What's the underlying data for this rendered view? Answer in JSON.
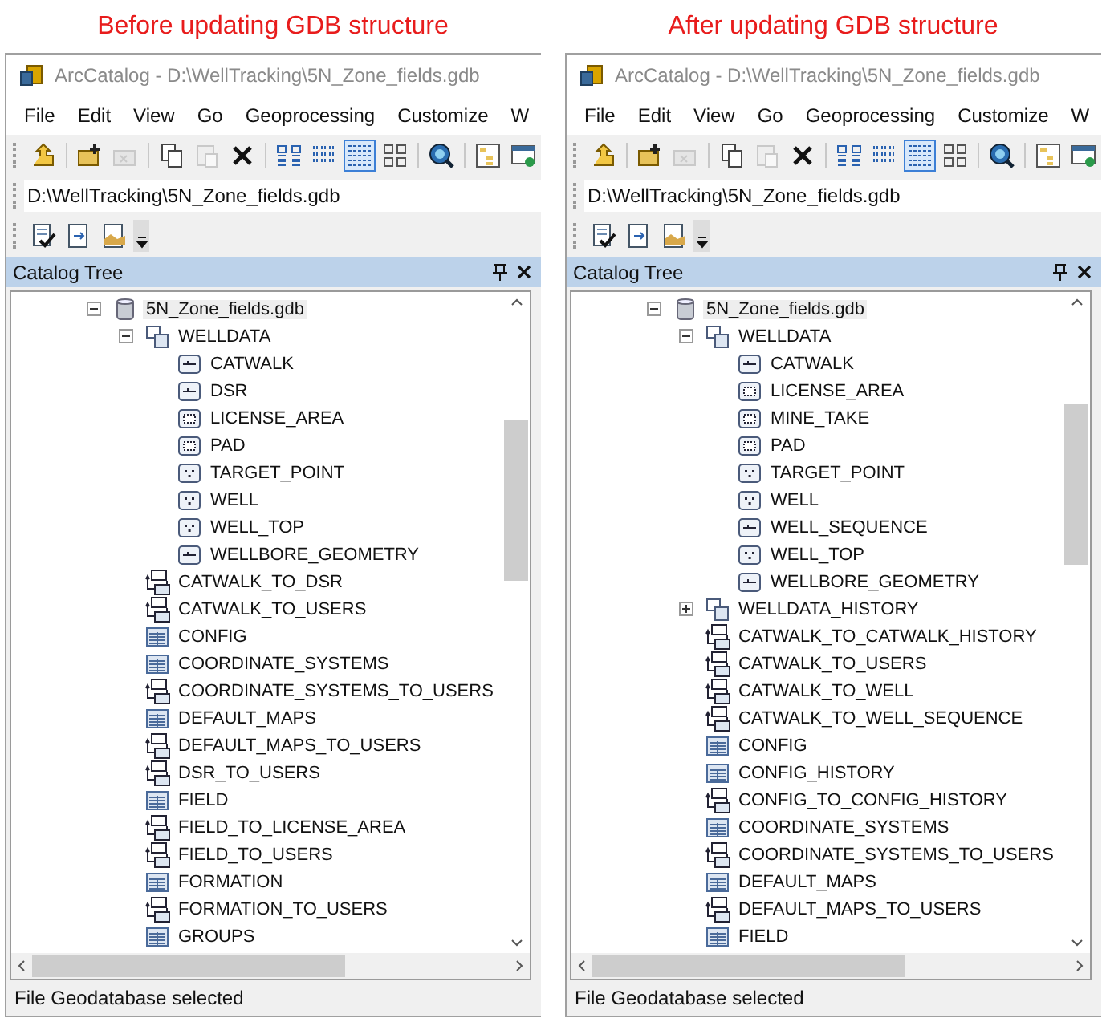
{
  "panels": [
    {
      "caption": "Before updating GDB structure",
      "window": {
        "title": "ArcCatalog - D:\\WellTracking\\5N_Zone_fields.gdb"
      },
      "menu": [
        "File",
        "Edit",
        "View",
        "Go",
        "Geoprocessing",
        "Customize",
        "W"
      ],
      "toolbar": [
        {
          "kind": "up",
          "disabled": false,
          "selected": false
        },
        {
          "kind": "connect",
          "disabled": false,
          "selected": false
        },
        {
          "kind": "disconnect",
          "disabled": true,
          "selected": false
        },
        {
          "kind": "copy",
          "disabled": false,
          "selected": false
        },
        {
          "kind": "paste",
          "disabled": true,
          "selected": false
        },
        {
          "kind": "delete",
          "disabled": false,
          "selected": false
        },
        {
          "kind": "large-icons",
          "disabled": false,
          "selected": false
        },
        {
          "kind": "list",
          "disabled": false,
          "selected": false
        },
        {
          "kind": "details",
          "disabled": false,
          "selected": true
        },
        {
          "kind": "thumbnails",
          "disabled": false,
          "selected": false
        },
        {
          "kind": "search",
          "disabled": false,
          "selected": false
        },
        {
          "kind": "catalog",
          "disabled": false,
          "selected": false
        },
        {
          "kind": "window",
          "disabled": false,
          "selected": false
        }
      ],
      "address": "D:\\WellTracking\\5N_Zone_fields.gdb",
      "toolbar2": [
        {
          "kind": "check"
        },
        {
          "kind": "import"
        },
        {
          "kind": "export"
        },
        {
          "kind": "overflow"
        }
      ],
      "tree_title": "Catalog Tree",
      "tree": [
        {
          "label": "5N_Zone_fields.gdb",
          "kind": "gdb",
          "expanded": true,
          "children": [
            {
              "label": "WELLDATA",
              "kind": "dataset",
              "expanded": true,
              "children": [
                {
                  "label": "CATWALK",
                  "kind": "line"
                },
                {
                  "label": "DSR",
                  "kind": "line"
                },
                {
                  "label": "LICENSE_AREA",
                  "kind": "polygon"
                },
                {
                  "label": "PAD",
                  "kind": "polygon"
                },
                {
                  "label": "TARGET_POINT",
                  "kind": "point"
                },
                {
                  "label": "WELL",
                  "kind": "point"
                },
                {
                  "label": "WELL_TOP",
                  "kind": "point"
                },
                {
                  "label": "WELLBORE_GEOMETRY",
                  "kind": "line"
                }
              ]
            },
            {
              "label": "CATWALK_TO_DSR",
              "kind": "relationship"
            },
            {
              "label": "CATWALK_TO_USERS",
              "kind": "relationship"
            },
            {
              "label": "CONFIG",
              "kind": "table"
            },
            {
              "label": "COORDINATE_SYSTEMS",
              "kind": "table"
            },
            {
              "label": "COORDINATE_SYSTEMS_TO_USERS",
              "kind": "relationship"
            },
            {
              "label": "DEFAULT_MAPS",
              "kind": "table"
            },
            {
              "label": "DEFAULT_MAPS_TO_USERS",
              "kind": "relationship"
            },
            {
              "label": "DSR_TO_USERS",
              "kind": "relationship"
            },
            {
              "label": "FIELD",
              "kind": "table"
            },
            {
              "label": "FIELD_TO_LICENSE_AREA",
              "kind": "relationship"
            },
            {
              "label": "FIELD_TO_USERS",
              "kind": "relationship"
            },
            {
              "label": "FORMATION",
              "kind": "table"
            },
            {
              "label": "FORMATION_TO_USERS",
              "kind": "relationship"
            },
            {
              "label": "GROUPS",
              "kind": "table"
            }
          ]
        }
      ],
      "status": "File Geodatabase selected"
    },
    {
      "caption": "After updating GDB structure",
      "window": {
        "title": "ArcCatalog - D:\\WellTracking\\5N_Zone_fields.gdb"
      },
      "menu": [
        "File",
        "Edit",
        "View",
        "Go",
        "Geoprocessing",
        "Customize",
        "W"
      ],
      "toolbar": [
        {
          "kind": "up",
          "disabled": false,
          "selected": false
        },
        {
          "kind": "connect",
          "disabled": false,
          "selected": false
        },
        {
          "kind": "disconnect",
          "disabled": true,
          "selected": false
        },
        {
          "kind": "copy",
          "disabled": false,
          "selected": false
        },
        {
          "kind": "paste",
          "disabled": true,
          "selected": false
        },
        {
          "kind": "delete",
          "disabled": false,
          "selected": false
        },
        {
          "kind": "large-icons",
          "disabled": false,
          "selected": false
        },
        {
          "kind": "list",
          "disabled": false,
          "selected": false
        },
        {
          "kind": "details",
          "disabled": false,
          "selected": true
        },
        {
          "kind": "thumbnails",
          "disabled": false,
          "selected": false
        },
        {
          "kind": "search",
          "disabled": false,
          "selected": false
        },
        {
          "kind": "catalog",
          "disabled": false,
          "selected": false
        },
        {
          "kind": "window",
          "disabled": false,
          "selected": false
        }
      ],
      "address": "D:\\WellTracking\\5N_Zone_fields.gdb",
      "toolbar2": [
        {
          "kind": "check"
        },
        {
          "kind": "import"
        },
        {
          "kind": "export"
        },
        {
          "kind": "overflow"
        }
      ],
      "tree_title": "Catalog Tree",
      "tree": [
        {
          "label": "5N_Zone_fields.gdb",
          "kind": "gdb",
          "expanded": true,
          "children": [
            {
              "label": "WELLDATA",
              "kind": "dataset",
              "expanded": true,
              "children": [
                {
                  "label": "CATWALK",
                  "kind": "line"
                },
                {
                  "label": "LICENSE_AREA",
                  "kind": "polygon"
                },
                {
                  "label": "MINE_TAKE",
                  "kind": "polygon"
                },
                {
                  "label": "PAD",
                  "kind": "polygon"
                },
                {
                  "label": "TARGET_POINT",
                  "kind": "point"
                },
                {
                  "label": "WELL",
                  "kind": "point"
                },
                {
                  "label": "WELL_SEQUENCE",
                  "kind": "line"
                },
                {
                  "label": "WELL_TOP",
                  "kind": "point"
                },
                {
                  "label": "WELLBORE_GEOMETRY",
                  "kind": "line"
                }
              ]
            },
            {
              "label": "WELLDATA_HISTORY",
              "kind": "dataset",
              "expanded": false
            },
            {
              "label": "CATWALK_TO_CATWALK_HISTORY",
              "kind": "relationship"
            },
            {
              "label": "CATWALK_TO_USERS",
              "kind": "relationship"
            },
            {
              "label": "CATWALK_TO_WELL",
              "kind": "relationship"
            },
            {
              "label": "CATWALK_TO_WELL_SEQUENCE",
              "kind": "relationship"
            },
            {
              "label": "CONFIG",
              "kind": "table"
            },
            {
              "label": "CONFIG_HISTORY",
              "kind": "table"
            },
            {
              "label": "CONFIG_TO_CONFIG_HISTORY",
              "kind": "relationship"
            },
            {
              "label": "COORDINATE_SYSTEMS",
              "kind": "table"
            },
            {
              "label": "COORDINATE_SYSTEMS_TO_USERS",
              "kind": "relationship"
            },
            {
              "label": "DEFAULT_MAPS",
              "kind": "table"
            },
            {
              "label": "DEFAULT_MAPS_TO_USERS",
              "kind": "relationship"
            },
            {
              "label": "FIELD",
              "kind": "table"
            }
          ]
        }
      ],
      "status": "File Geodatabase selected"
    }
  ]
}
